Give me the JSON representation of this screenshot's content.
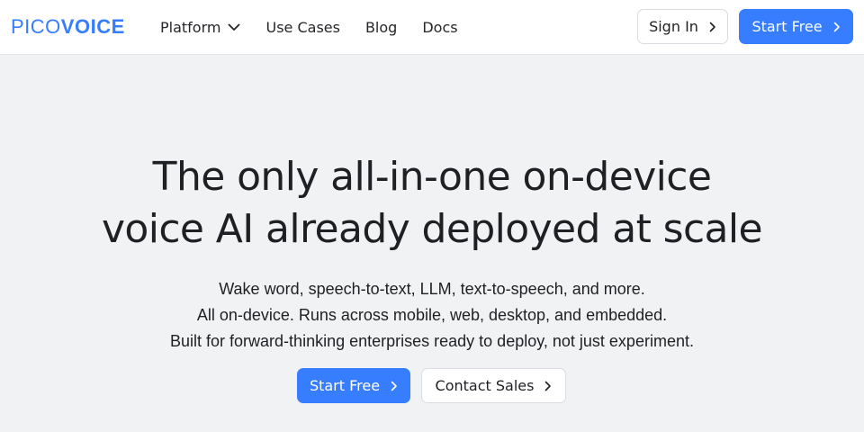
{
  "header": {
    "logo": {
      "part1": "PICO",
      "part2": "VOICE",
      "color": "#377dff"
    },
    "nav": [
      {
        "label": "Platform",
        "has_dropdown": true,
        "icon": "chevron-down-icon"
      },
      {
        "label": "Use Cases"
      },
      {
        "label": "Blog"
      },
      {
        "label": "Docs"
      }
    ],
    "sign_in_label": "Sign In",
    "start_free_label": "Start Free"
  },
  "hero": {
    "title_lines": [
      "The only all-in-one on-device",
      "voice AI already deployed at scale"
    ],
    "subtitle_lines": [
      "Wake word, speech-to-text, LLM, text-to-speech, and more.",
      "All on-device. Runs across mobile, web, desktop, and embedded.",
      "Built for forward-thinking enterprises ready to deploy, not just experiment."
    ],
    "primary_cta_label": "Start Free",
    "secondary_cta_label": "Contact Sales"
  },
  "colors": {
    "accent": "#377dff",
    "background": "#f1f2f4",
    "header_background": "#ffffff",
    "text": "#1f2023"
  },
  "icons": {
    "button_chevron": "chevron-right-icon",
    "dropdown_chevron": "chevron-down-icon"
  }
}
